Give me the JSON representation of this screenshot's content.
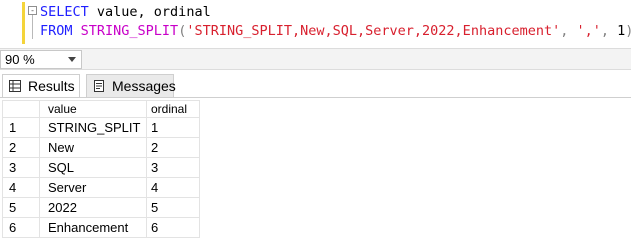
{
  "editor": {
    "collapse_glyph": "-",
    "line1": {
      "kw1": "SELECT",
      "rest": " value, ordinal"
    },
    "line2": {
      "kw": "FROM",
      "space": " ",
      "fn": "STRING_SPLIT",
      "paren_open": "(",
      "str1": "'STRING_SPLIT,New,SQL,Server,2022,Enhancement'",
      "comma1": ", ",
      "str2": "','",
      "comma2": ", ",
      "num": "1",
      "paren_close": ")"
    }
  },
  "zoom": {
    "value": "90 %"
  },
  "tabs": [
    {
      "label": "Results",
      "icon": "grid-icon"
    },
    {
      "label": "Messages",
      "icon": "messages-icon"
    }
  ],
  "results": {
    "columns": [
      "value",
      "ordinal"
    ],
    "rows": [
      {
        "num": "1",
        "value": "STRING_SPLIT",
        "ordinal": "1"
      },
      {
        "num": "2",
        "value": "New",
        "ordinal": "2"
      },
      {
        "num": "3",
        "value": "SQL",
        "ordinal": "3"
      },
      {
        "num": "4",
        "value": "Server",
        "ordinal": "4"
      },
      {
        "num": "5",
        "value": "2022",
        "ordinal": "5"
      },
      {
        "num": "6",
        "value": "Enhancement",
        "ordinal": "6"
      }
    ]
  },
  "colors": {
    "margin_indicator": "#f4d43a",
    "keyword": "#1f1fff",
    "function": "#c800c8",
    "string": "#d8202e"
  }
}
